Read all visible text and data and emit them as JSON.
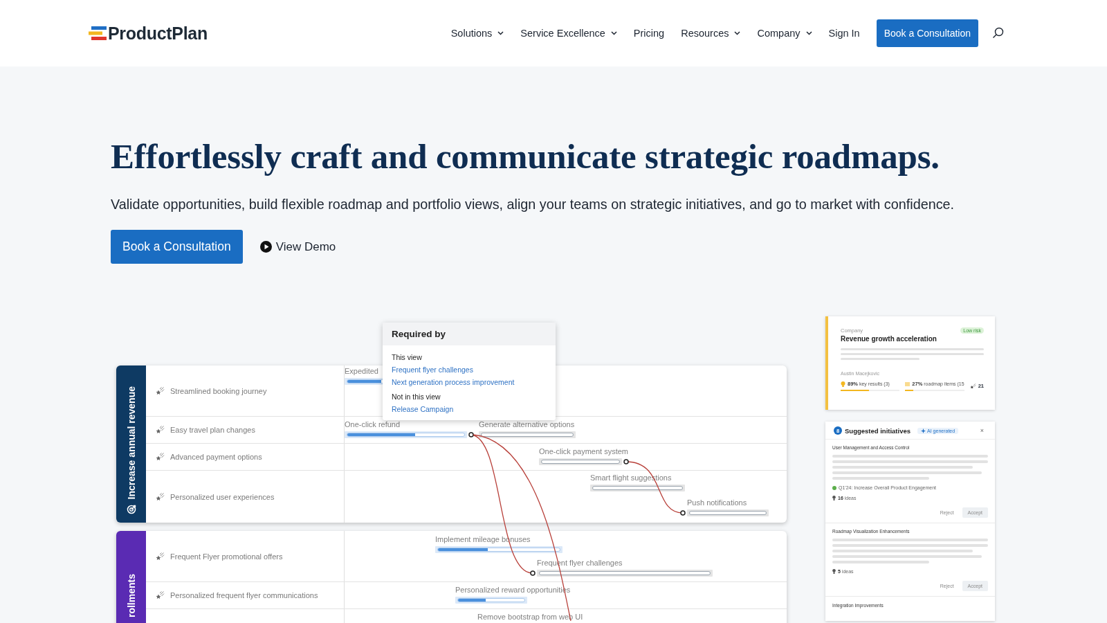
{
  "header": {
    "logo": "ProductPlan",
    "nav": [
      {
        "label": "Solutions",
        "dropdown": true
      },
      {
        "label": "Service Excellence",
        "dropdown": true
      },
      {
        "label": "Pricing",
        "dropdown": false
      },
      {
        "label": "Resources",
        "dropdown": true
      },
      {
        "label": "Company",
        "dropdown": true
      },
      {
        "label": "Sign In",
        "dropdown": false
      }
    ],
    "cta": "Book a Consultation"
  },
  "hero": {
    "title": "Effortlessly craft and communicate strategic roadmaps.",
    "subtitle": "Validate opportunities, build flexible roadmap and portfolio views, align your teams on strategic initiatives, and go to market with confidence.",
    "primary_button": "Book a Consultation",
    "demo_link": "View Demo"
  },
  "roadmap": {
    "lanes": [
      {
        "title": "Increase annual revenue",
        "color": "#0e3a63",
        "rows": [
          {
            "name": "Streamlined booking journey",
            "bars": [
              {
                "label": "Expedited",
                "kind": "progress",
                "level": 0.9
              }
            ]
          },
          {
            "name": "Easy travel plan changes",
            "bars": [
              {
                "label": "One-click refund",
                "kind": "progress",
                "level": 0.58
              },
              {
                "label": "Generate alternative options",
                "kind": "planned"
              }
            ]
          },
          {
            "name": "Advanced payment options",
            "bars": [
              {
                "label": "One-click payment system",
                "kind": "planned"
              }
            ]
          },
          {
            "name": "Personalized user experiences",
            "bars": [
              {
                "label": "Smart flight suggestions",
                "kind": "planned"
              },
              {
                "label": "Push notifications",
                "kind": "planned"
              }
            ]
          }
        ]
      },
      {
        "title": "rollments",
        "color": "#5a2bb3",
        "rows": [
          {
            "name": "Frequent Flyer promotional offers",
            "bars": [
              {
                "label": "Implement mileage bonuses",
                "kind": "progress",
                "level": 0.41
              },
              {
                "label": "Frequent flyer challenges",
                "kind": "planned"
              }
            ]
          },
          {
            "name": "Personalized frequent flyer communications",
            "bars": [
              {
                "label": "Personalized reward opportunities",
                "kind": "progress",
                "level": 0.42
              }
            ]
          },
          {
            "bars": [
              {
                "label": "Remove bootstrap from web UI",
                "kind": "label"
              }
            ]
          }
        ]
      }
    ],
    "popover": {
      "title": "Required by",
      "sections": [
        {
          "heading": "This view",
          "links": [
            "Frequent flyer challenges",
            "Next generation process improvement"
          ]
        },
        {
          "heading": "Not in this view",
          "links": [
            "Release Campaign"
          ]
        }
      ]
    }
  },
  "goal_card": {
    "category": "Company",
    "risk": "Low risk",
    "title": "Revenue growth acceleration",
    "owner": "Austin Macejkovic",
    "metrics": [
      {
        "kind": "key_results",
        "value": "89%",
        "label": "key results (3)",
        "level": 0.48
      },
      {
        "kind": "roadmap_items",
        "value": "27%",
        "label": "roadmap items (15",
        "level": 0.14
      }
    ],
    "count": "21"
  },
  "suggestions": {
    "count": "8",
    "title": "Suggested initiatives",
    "tag": "AI generated",
    "close": "×",
    "items": [
      {
        "title": "User Management and Access Control",
        "objective": "Q1'24: Increase Overall Product Engagement",
        "ideas": "**16** ideas",
        "actions": [
          "Reject",
          "Accept"
        ]
      },
      {
        "title": "Roadmap Visualization Enhancements",
        "ideas": "**5** ideas",
        "actions": [
          "Reject",
          "Accept"
        ]
      }
    ],
    "more": "Integration Improvements"
  }
}
